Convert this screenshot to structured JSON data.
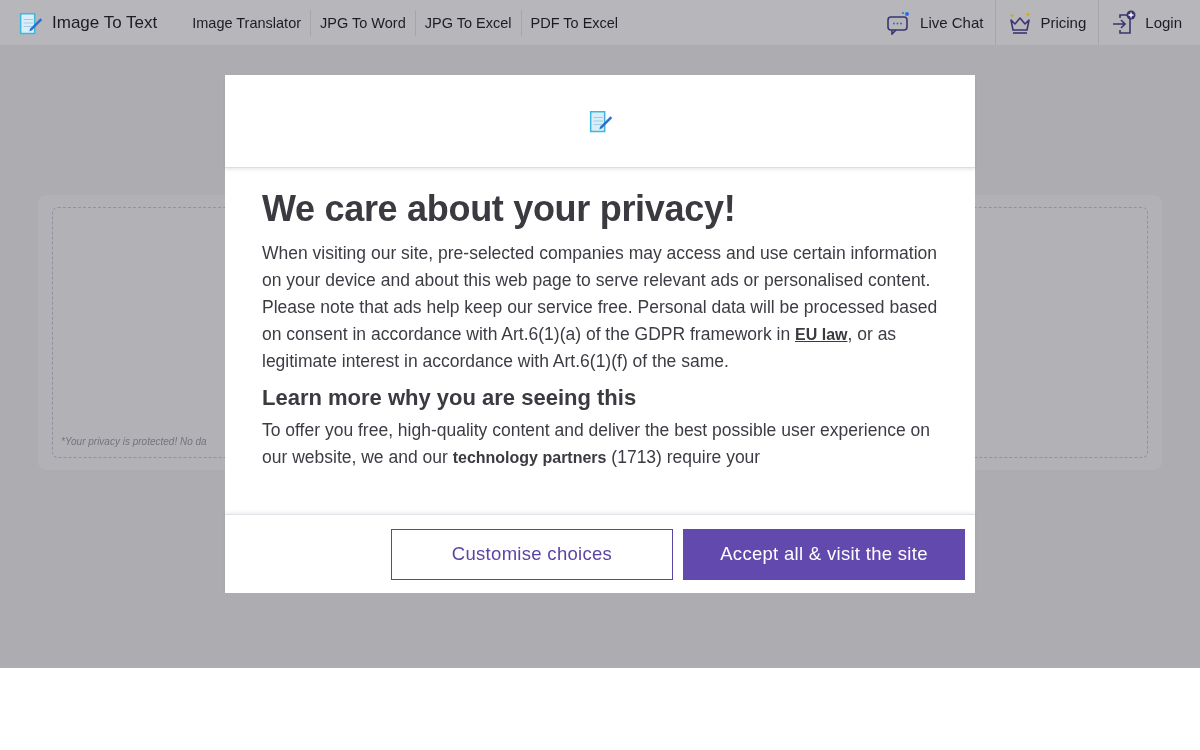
{
  "nav": {
    "brand": "Image To Text",
    "links": [
      "Image Translator",
      "JPG To Word",
      "JPG To Excel",
      "PDF To Excel"
    ],
    "actions": [
      {
        "kind": "chat",
        "label": "Live Chat"
      },
      {
        "kind": "pricing",
        "label": "Pricing"
      },
      {
        "kind": "login",
        "label": "Login"
      }
    ]
  },
  "upload_card": {
    "note": "*Your privacy is protected! No da"
  },
  "consent_dialog": {
    "title": "We care about your privacy!",
    "intro": [
      {
        "text": "When visiting our site, pre-selected companies may access and use certain information on your device and about this web page to serve relevant ads or personalised content. Please note that ads help keep our service free. Personal data will be processed based on consent in accordance with Art.6(1)(a) of the GDPR framework in "
      },
      {
        "link": "EU law"
      },
      {
        "text": ", or as legitimate interest in accordance with Art.6(1)(f) of the same."
      }
    ],
    "subtitle": "Learn more why you are seeing this",
    "details": [
      {
        "text": "To offer you free, high-quality content and deliver the best possible user experience on our website, we and our "
      },
      {
        "link": "technology partners"
      },
      {
        "text": " (1713) require your"
      }
    ],
    "buttons": [
      {
        "kind": "secondary",
        "label": "Customise choices"
      },
      {
        "kind": "primary",
        "label": "Accept all & visit the site"
      }
    ]
  }
}
